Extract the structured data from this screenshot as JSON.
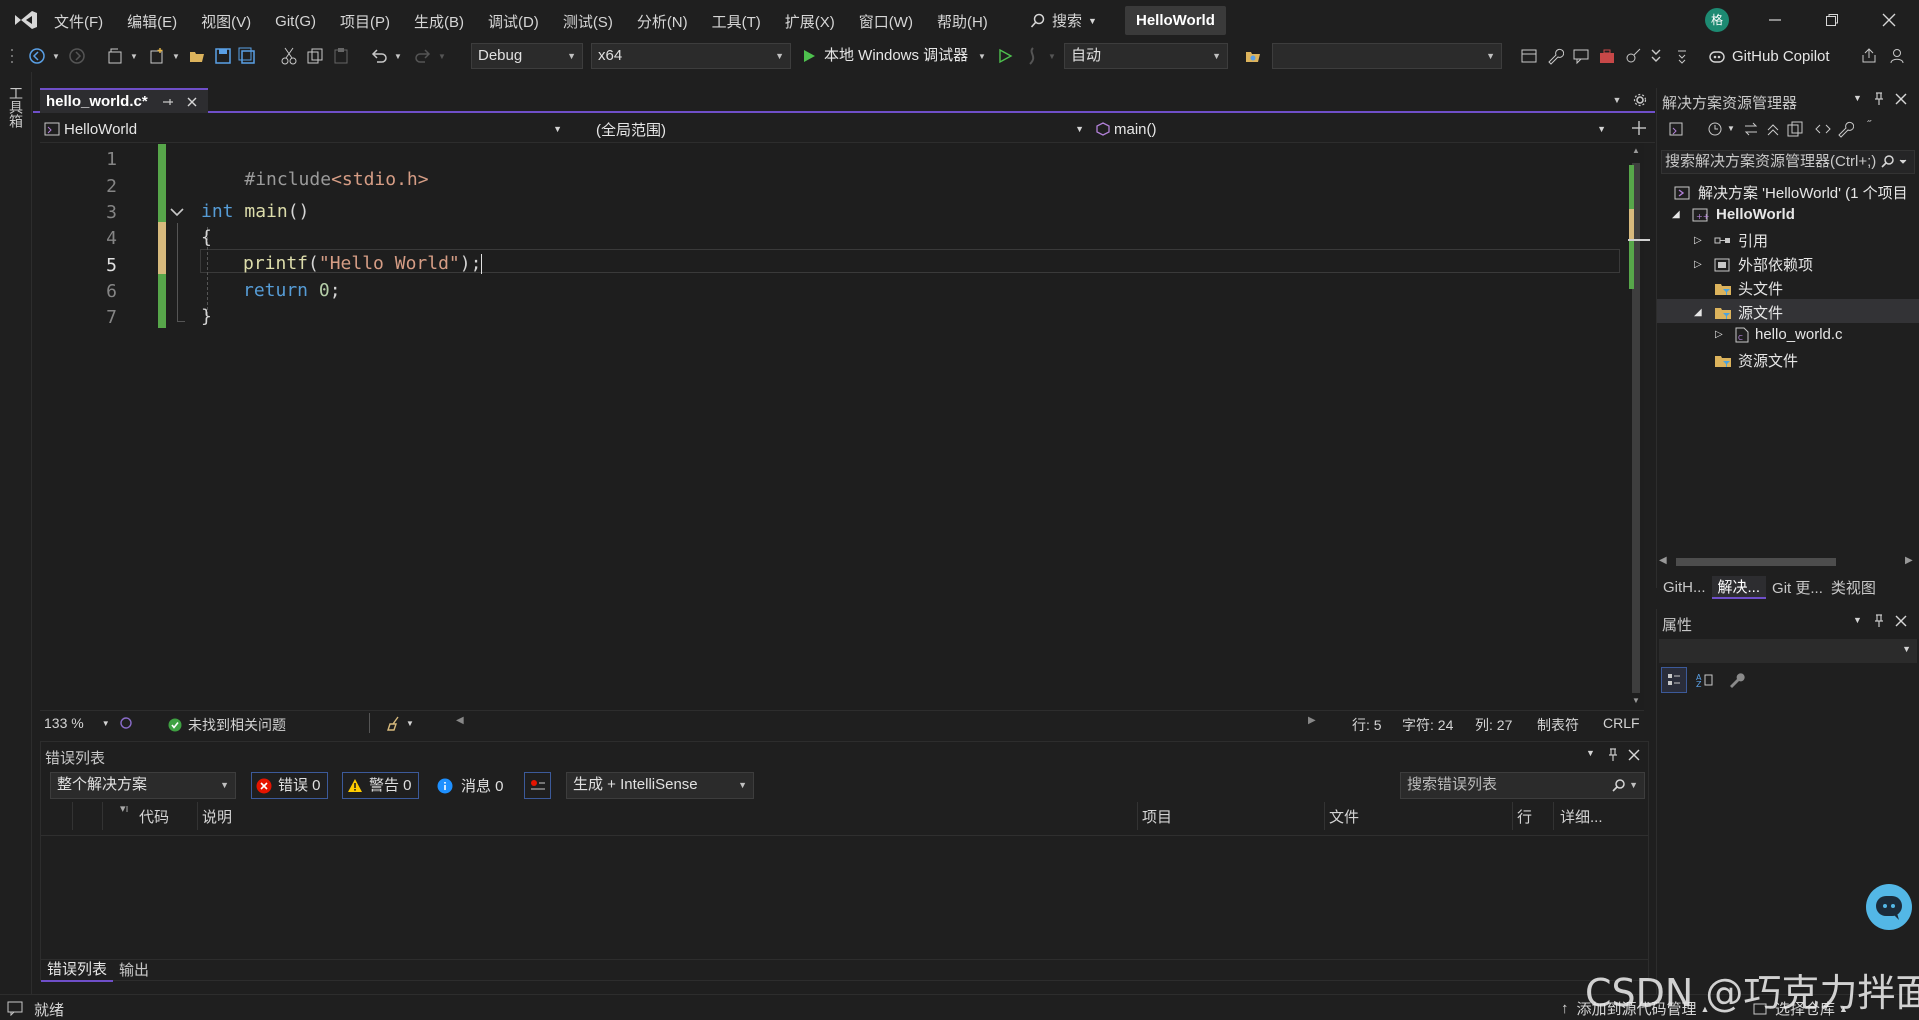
{
  "app": {
    "solution_title": "HelloWorld",
    "avatar_initial": "格",
    "menu": [
      "文件(F)",
      "编辑(E)",
      "视图(V)",
      "Git(G)",
      "项目(P)",
      "生成(B)",
      "调试(D)",
      "测试(S)",
      "分析(N)",
      "工具(T)",
      "扩展(X)",
      "窗口(W)",
      "帮助(H)"
    ],
    "search_label": "搜索"
  },
  "toolbar": {
    "config": "Debug",
    "platform": "x64",
    "run_label": "本地 Windows 调试器",
    "auto_label": "自动",
    "copilot_label": "GitHub Copilot"
  },
  "toolbox_label": "工具箱",
  "editor": {
    "tab_label": "hello_world.c*",
    "nav_project": "HelloWorld",
    "nav_scope": "(全局范围)",
    "nav_member": "main()",
    "lines": [
      {
        "num": "1",
        "text": "#include<stdio.h>"
      },
      {
        "num": "2",
        "text": ""
      },
      {
        "num": "3",
        "text": "int main()"
      },
      {
        "num": "4",
        "text": "{"
      },
      {
        "num": "5",
        "text": "printf(\"Hello World\");"
      },
      {
        "num": "6",
        "text": "return 0;"
      },
      {
        "num": "7",
        "text": "}"
      }
    ],
    "code_colors": {
      "keyword": "#569cd6",
      "string": "#d69d85",
      "preproc": "#9b9b9b",
      "number": "#b5cea8",
      "function": "#dcdcaa"
    },
    "zoom": "133 %",
    "issues": "未找到相关问题",
    "position": {
      "line": "行: 5",
      "char": "字符: 24",
      "col": "列: 27"
    },
    "indent": "制表符",
    "eol": "CRLF"
  },
  "errorlist": {
    "title": "错误列表",
    "scope": "整个解决方案",
    "errors": "错误 0",
    "warnings": "警告 0",
    "messages": "消息 0",
    "filter": "生成 + IntelliSense",
    "search_placeholder": "搜索错误列表",
    "columns": {
      "code": "代码",
      "desc": "说明",
      "project": "项目",
      "file": "文件",
      "line": "行",
      "detail": "详细..."
    },
    "tabs": [
      "错误列表",
      "输出"
    ]
  },
  "solution_explorer": {
    "title": "解决方案资源管理器",
    "search_placeholder": "搜索解决方案资源管理器(Ctrl+;)",
    "items": {
      "solution": "解决方案 'HelloWorld' (1 个项目",
      "project": "HelloWorld",
      "refs": "引用",
      "ext_deps": "外部依赖项",
      "headers": "头文件",
      "sources": "源文件",
      "file": "hello_world.c",
      "resources": "资源文件"
    },
    "bottom_tabs": [
      "GitH...",
      "解决...",
      "Git 更...",
      "类视图"
    ]
  },
  "properties": {
    "title": "属性"
  },
  "statusbar": {
    "ready": "就绪",
    "add_source": "添加到源代码管理",
    "select_repo": "选择仓库"
  },
  "watermark": "CSDN @巧克力拌面"
}
